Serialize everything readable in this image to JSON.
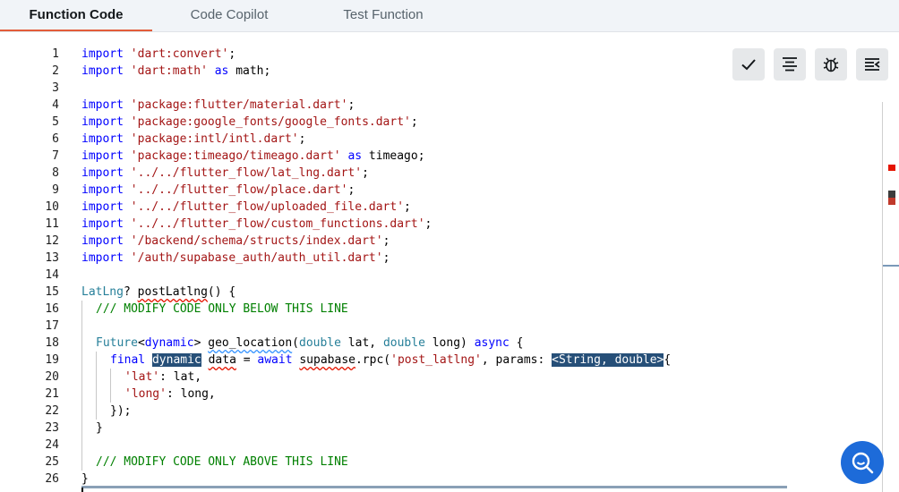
{
  "tabs": [
    {
      "label": "Function Code",
      "active": true
    },
    {
      "label": "Code Copilot",
      "active": false
    },
    {
      "label": "Test Function",
      "active": false
    }
  ],
  "toolbar": [
    {
      "name": "check-button",
      "icon": "check-icon"
    },
    {
      "name": "format-button",
      "icon": "align-center-icon"
    },
    {
      "name": "debug-button",
      "icon": "bug-icon"
    },
    {
      "name": "wrap-button",
      "icon": "wrap-lines-icon"
    }
  ],
  "colors": {
    "keyword": "#0000ff",
    "string": "#a31515",
    "type": "#267f99",
    "comment": "#008000",
    "selection": "#264f78",
    "tab_underline": "#e35d3a",
    "fab": "#1d6bd9"
  },
  "code": {
    "line_numbers": [
      "1",
      "2",
      "3",
      "4",
      "5",
      "6",
      "7",
      "8",
      "9",
      "10",
      "11",
      "12",
      "13",
      "14",
      "15",
      "16",
      "17",
      "18",
      "19",
      "20",
      "21",
      "22",
      "23",
      "24",
      "25",
      "26"
    ],
    "l1": {
      "kw": "import",
      "str": "'dart:convert'",
      "end": ";"
    },
    "l2": {
      "kw": "import",
      "str": "'dart:math'",
      "as": "as",
      "rest": "math;"
    },
    "l4": {
      "kw": "import",
      "str": "'package:flutter/material.dart'",
      "end": ";"
    },
    "l5": {
      "kw": "import",
      "str": "'package:google_fonts/google_fonts.dart'",
      "end": ";"
    },
    "l6": {
      "kw": "import",
      "str": "'package:intl/intl.dart'",
      "end": ";"
    },
    "l7": {
      "kw": "import",
      "str": "'package:timeago/timeago.dart'",
      "as": "as",
      "rest": "timeago;"
    },
    "l8": {
      "kw": "import",
      "str": "'../../flutter_flow/lat_lng.dart'",
      "end": ";"
    },
    "l9": {
      "kw": "import",
      "str": "'../../flutter_flow/place.dart'",
      "end": ";"
    },
    "l10": {
      "kw": "import",
      "str": "'../../flutter_flow/uploaded_file.dart'",
      "end": ";"
    },
    "l11": {
      "kw": "import",
      "str": "'../../flutter_flow/custom_functions.dart'",
      "end": ";"
    },
    "l12": {
      "kw": "import",
      "str": "'/backend/schema/structs/index.dart'",
      "end": ";"
    },
    "l13": {
      "kw": "import",
      "str": "'/auth/supabase_auth/auth_util.dart'",
      "end": ";"
    },
    "l15": {
      "type": "LatLng",
      "q": "? ",
      "fn": "postLatlng",
      "rest": "() {"
    },
    "l16": {
      "cmt": "/// MODIFY CODE ONLY BELOW THIS LINE"
    },
    "l18": {
      "type": "Future",
      "lt": "<",
      "kw": "dynamic",
      "gt": "> ",
      "fn": "geo_location",
      "p1": "(",
      "t1": "double",
      "a1": " lat, ",
      "t2": "double",
      "a2": " long) ",
      "kw2": "async",
      "end": " {"
    },
    "l19": {
      "kw": "final",
      "sel": "dynamic",
      "var": "data",
      "eq": " = ",
      "kw2": "await",
      "obj": "supabase",
      "call": ".rpc(",
      "str": "'post_latlng'",
      "mid": ", params: ",
      "sel2": "<String, double>",
      "end": "{"
    },
    "l20": {
      "str": "'lat'",
      "rest": ": lat,"
    },
    "l21": {
      "str": "'long'",
      "rest": ": long,"
    },
    "l22": {
      "text": "});"
    },
    "l23": {
      "text": "}"
    },
    "l25": {
      "cmt": "/// MODIFY CODE ONLY ABOVE THIS LINE"
    },
    "l26": {
      "text": "}"
    }
  },
  "chat_button": {
    "icon": "search-chat-icon"
  }
}
